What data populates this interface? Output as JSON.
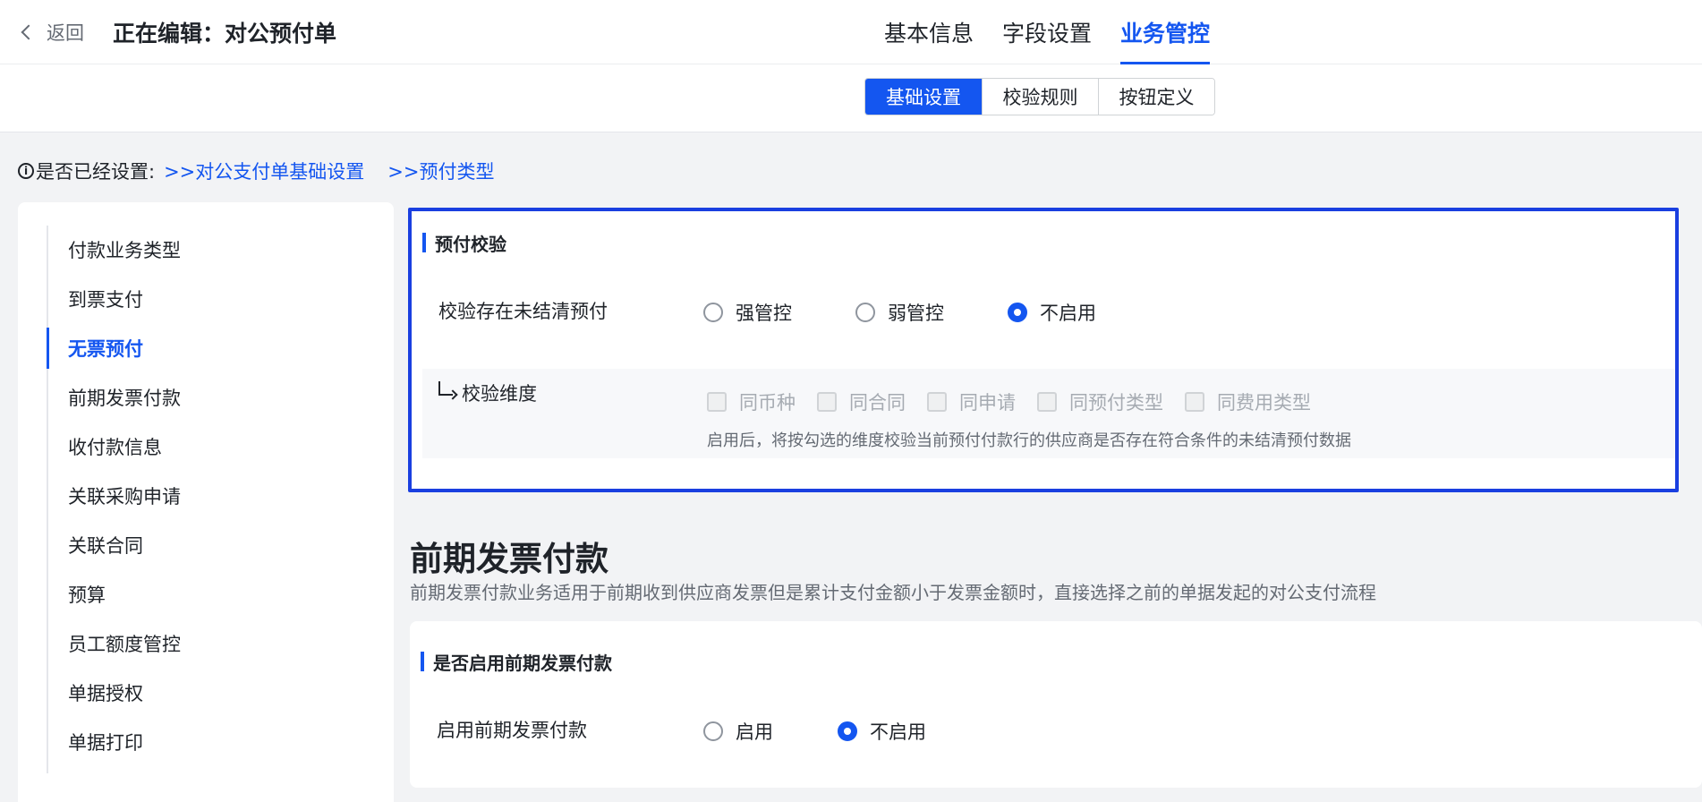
{
  "header": {
    "back_label": "返回",
    "title": "正在编辑：对公预付单",
    "tabs": [
      {
        "label": "基本信息",
        "active": false
      },
      {
        "label": "字段设置",
        "active": false
      },
      {
        "label": "业务管控",
        "active": true
      }
    ]
  },
  "subtabs": [
    {
      "label": "基础设置",
      "active": true
    },
    {
      "label": "校验规则",
      "active": false
    },
    {
      "label": "按钮定义",
      "active": false
    }
  ],
  "info": {
    "prefix": "是否已经设置:",
    "links": [
      ">>对公支付单基础设置",
      ">>预付类型"
    ]
  },
  "sidebar": {
    "items": [
      {
        "label": "付款业务类型",
        "active": false
      },
      {
        "label": "到票支付",
        "active": false
      },
      {
        "label": "无票预付",
        "active": true
      },
      {
        "label": "前期发票付款",
        "active": false
      },
      {
        "label": "收付款信息",
        "active": false
      },
      {
        "label": "关联采购申请",
        "active": false
      },
      {
        "label": "关联合同",
        "active": false
      },
      {
        "label": "预算",
        "active": false
      },
      {
        "label": "员工额度管控",
        "active": false
      },
      {
        "label": "单据授权",
        "active": false
      },
      {
        "label": "单据打印",
        "active": false
      }
    ]
  },
  "prepay_check": {
    "section_title": "预付校验",
    "row_label": "校验存在未结清预付",
    "options": [
      {
        "label": "强管控",
        "checked": false
      },
      {
        "label": "弱管控",
        "checked": false
      },
      {
        "label": "不启用",
        "checked": true
      }
    ],
    "dimension": {
      "label": "校验维度",
      "options": [
        "同币种",
        "同合同",
        "同申请",
        "同预付类型",
        "同费用类型"
      ],
      "hint": "启用后，将按勾选的维度校验当前预付付款行的供应商是否存在符合条件的未结清预付数据"
    }
  },
  "prior_invoice": {
    "title": "前期发票付款",
    "description": "前期发票付款业务适用于前期收到供应商发票但是累计支付金额小于发票金额时，直接选择之前的单据发起的对公支付流程",
    "section_title": "是否启用前期发票付款",
    "row_label": "启用前期发票付款",
    "options": [
      {
        "label": "启用",
        "checked": false
      },
      {
        "label": "不启用",
        "checked": true
      }
    ]
  },
  "colors": {
    "accent": "#1456f0",
    "highlight_border": "#1a3fe0"
  }
}
